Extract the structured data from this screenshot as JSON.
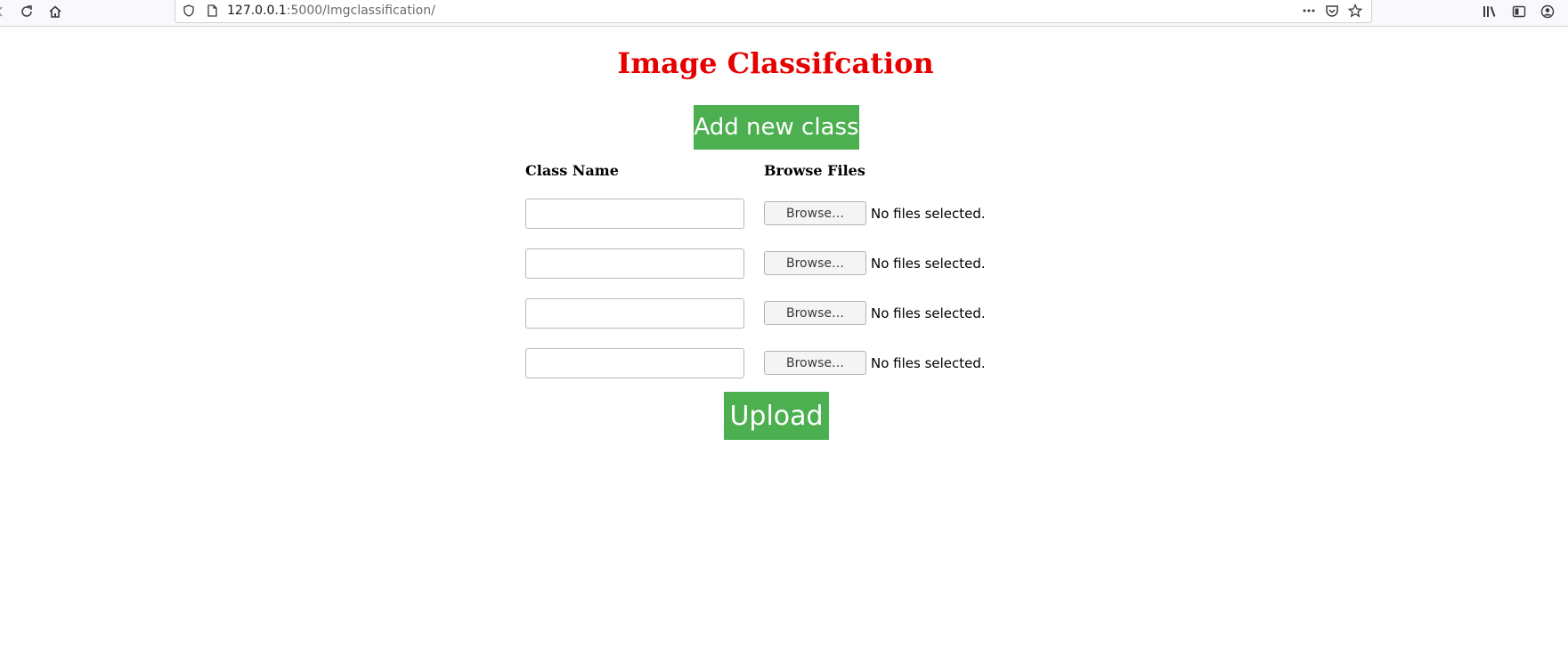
{
  "browser": {
    "url_host": "127.0.0.1",
    "url_rest": ":5000/Imgclassification/",
    "icons": {
      "back": "back-arrow-icon",
      "reload": "reload-icon",
      "home": "home-icon",
      "shield": "shield-icon",
      "page": "page-icon",
      "menu": "more-dots-icon",
      "pocket": "pocket-icon",
      "bookmark": "star-icon",
      "library": "library-icon",
      "sidebar": "sidebar-icon",
      "account": "account-icon"
    }
  },
  "page": {
    "title": "Image Classifcation",
    "title_color": "#e60000",
    "add_button_label": "Add new class",
    "upload_button_label": "Upload",
    "accent_color": "#4caf50",
    "headers": {
      "class_name": "Class Name",
      "browse_files": "Browse Files"
    },
    "rows": [
      {
        "class_name": "",
        "browse_label": "Browse…",
        "file_status": "No files selected."
      },
      {
        "class_name": "",
        "browse_label": "Browse…",
        "file_status": "No files selected."
      },
      {
        "class_name": "",
        "browse_label": "Browse…",
        "file_status": "No files selected."
      },
      {
        "class_name": "",
        "browse_label": "Browse…",
        "file_status": "No files selected."
      }
    ]
  }
}
